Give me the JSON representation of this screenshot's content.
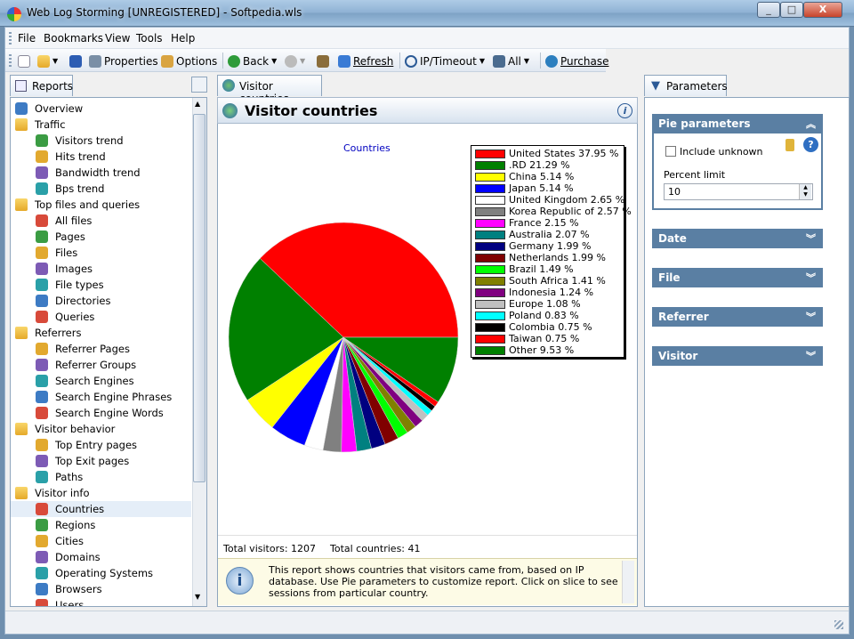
{
  "window": {
    "title": "Web Log Storming [UNREGISTERED] - Softpedia.wls",
    "min": "_",
    "max": "□",
    "close": "X"
  },
  "menu": [
    "File",
    "Bookmarks",
    "View",
    "Tools",
    "Help"
  ],
  "toolbar": {
    "properties": "Properties",
    "options": "Options",
    "back": "Back",
    "refresh": "Refresh",
    "ip_timeout": "IP/Timeout",
    "all": "All",
    "purchase": "Purchase"
  },
  "reports_tab": "Reports",
  "tree": [
    {
      "label": "Overview",
      "level": 0,
      "icon": "overview-icon"
    },
    {
      "label": "Traffic",
      "level": 0,
      "icon": "folder-icon",
      "folder": true
    },
    {
      "label": "Visitors trend",
      "level": 1,
      "icon": "visitors-trend-icon"
    },
    {
      "label": "Hits trend",
      "level": 1,
      "icon": "hits-trend-icon"
    },
    {
      "label": "Bandwidth trend",
      "level": 1,
      "icon": "bandwidth-icon"
    },
    {
      "label": "Bps trend",
      "level": 1,
      "icon": "bps-icon"
    },
    {
      "label": "Top files and queries",
      "level": 0,
      "icon": "folder-icon",
      "folder": true
    },
    {
      "label": "All files",
      "level": 1,
      "icon": "all-files-icon"
    },
    {
      "label": "Pages",
      "level": 1,
      "icon": "pages-icon"
    },
    {
      "label": "Files",
      "level": 1,
      "icon": "files-icon"
    },
    {
      "label": "Images",
      "level": 1,
      "icon": "images-icon"
    },
    {
      "label": "File types",
      "level": 1,
      "icon": "file-types-icon"
    },
    {
      "label": "Directories",
      "level": 1,
      "icon": "directories-icon"
    },
    {
      "label": "Queries",
      "level": 1,
      "icon": "queries-icon"
    },
    {
      "label": "Referrers",
      "level": 0,
      "icon": "folder-icon",
      "folder": true
    },
    {
      "label": "Referrer Pages",
      "level": 1,
      "icon": "referrer-pages-icon"
    },
    {
      "label": "Referrer Groups",
      "level": 1,
      "icon": "referrer-groups-icon"
    },
    {
      "label": "Search Engines",
      "level": 1,
      "icon": "search-engines-icon"
    },
    {
      "label": "Search Engine Phrases",
      "level": 1,
      "icon": "phrases-icon"
    },
    {
      "label": "Search Engine Words",
      "level": 1,
      "icon": "words-icon"
    },
    {
      "label": "Visitor behavior",
      "level": 0,
      "icon": "folder-icon",
      "folder": true
    },
    {
      "label": "Top Entry pages",
      "level": 1,
      "icon": "entry-pages-icon"
    },
    {
      "label": "Top Exit pages",
      "level": 1,
      "icon": "exit-pages-icon"
    },
    {
      "label": "Paths",
      "level": 1,
      "icon": "paths-icon"
    },
    {
      "label": "Visitor info",
      "level": 0,
      "icon": "folder-icon",
      "folder": true
    },
    {
      "label": "Countries",
      "level": 1,
      "icon": "globe-icon",
      "selected": true
    },
    {
      "label": "Regions",
      "level": 1,
      "icon": "regions-icon"
    },
    {
      "label": "Cities",
      "level": 1,
      "icon": "cities-icon"
    },
    {
      "label": "Domains",
      "level": 1,
      "icon": "domains-icon"
    },
    {
      "label": "Operating Systems",
      "level": 1,
      "icon": "windows-icon"
    },
    {
      "label": "Browsers",
      "level": 1,
      "icon": "browser-icon"
    },
    {
      "label": "Users",
      "level": 1,
      "icon": "users-icon"
    }
  ],
  "center": {
    "tab": "Visitor countries",
    "heading": "Visitor countries",
    "info_icon": "i",
    "total_visitors": "Total visitors: 1207",
    "total_countries": "Total countries: 41",
    "info_text": "This report shows countries that visitors came from, based on IP database. Use Pie parameters to customize report. Click on slice to see sessions from particular country."
  },
  "params": {
    "tab": "Parameters",
    "pie_title": "Pie parameters",
    "include_unknown": "Include unknown",
    "percent_limit_label": "Percent limit",
    "percent_limit": "10",
    "groups": [
      "Date",
      "File",
      "Referrer",
      "Visitor"
    ]
  },
  "chart_data": {
    "type": "pie",
    "title": "Countries",
    "slices": [
      {
        "label": "United States 37.95 %",
        "value": 37.95,
        "color": "#ff0000"
      },
      {
        "label": ".RD 21.29 %",
        "value": 21.29,
        "color": "#008000"
      },
      {
        "label": "China 5.14 %",
        "value": 5.14,
        "color": "#ffff00"
      },
      {
        "label": "Japan 5.14 %",
        "value": 5.14,
        "color": "#0000ff"
      },
      {
        "label": "United Kingdom 2.65 %",
        "value": 2.65,
        "color": "#ffffff"
      },
      {
        "label": "Korea  Republic of 2.57 %",
        "value": 2.57,
        "color": "#808080"
      },
      {
        "label": "France 2.15 %",
        "value": 2.15,
        "color": "#ff00ff"
      },
      {
        "label": "Australia 2.07 %",
        "value": 2.07,
        "color": "#008080"
      },
      {
        "label": "Germany 1.99 %",
        "value": 1.99,
        "color": "#000080"
      },
      {
        "label": "Netherlands 1.99 %",
        "value": 1.99,
        "color": "#800000"
      },
      {
        "label": "Brazil 1.49 %",
        "value": 1.49,
        "color": "#00ff00"
      },
      {
        "label": "South Africa 1.41 %",
        "value": 1.41,
        "color": "#808000"
      },
      {
        "label": "Indonesia 1.24 %",
        "value": 1.24,
        "color": "#800080"
      },
      {
        "label": "Europe 1.08 %",
        "value": 1.08,
        "color": "#c0c0c0"
      },
      {
        "label": "Poland 0.83 %",
        "value": 0.83,
        "color": "#00ffff"
      },
      {
        "label": "Colombia 0.75 %",
        "value": 0.75,
        "color": "#000000"
      },
      {
        "label": "Taiwan 0.75 %",
        "value": 0.75,
        "color": "#ff0000"
      },
      {
        "label": "Other 9.53 %",
        "value": 9.53,
        "color": "#008000"
      }
    ]
  }
}
